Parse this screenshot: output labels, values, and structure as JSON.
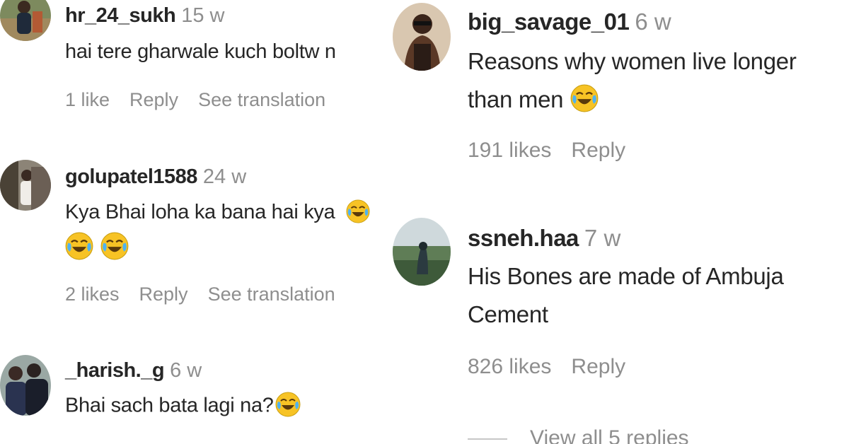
{
  "left_comments": [
    {
      "username": "hr_24_sukh",
      "time": "15 w",
      "text": "hai tere gharwale kuch boltw n",
      "likes": "1 like",
      "reply": "Reply",
      "translate": "See translation"
    },
    {
      "username": "golupatel1588",
      "time": "24 w",
      "text": "Kya Bhai loha ka bana hai kya",
      "likes": "2 likes",
      "reply": "Reply",
      "translate": "See translation"
    },
    {
      "username": "_harish._g",
      "time": "6 w",
      "text": "Bhai sach bata lagi na?"
    }
  ],
  "right_comments": [
    {
      "username": "big_savage_01",
      "time": "6 w",
      "text_line1": "Reasons why women live longer",
      "text_line2": "than men",
      "likes": "191 likes",
      "reply": "Reply"
    },
    {
      "username": "ssneh.haa",
      "time": "7 w",
      "text_line1": "His Bones are made of Ambuja",
      "text_line2": "Cement",
      "likes": "826 likes",
      "reply": "Reply",
      "view_replies": "View all 5 replies"
    }
  ],
  "icons": {
    "emoji": "face-with-tears-of-joy-icon"
  },
  "colors": {
    "username": "#262626",
    "muted": "#8e8e8e",
    "emoji_face": "#f7c325"
  }
}
